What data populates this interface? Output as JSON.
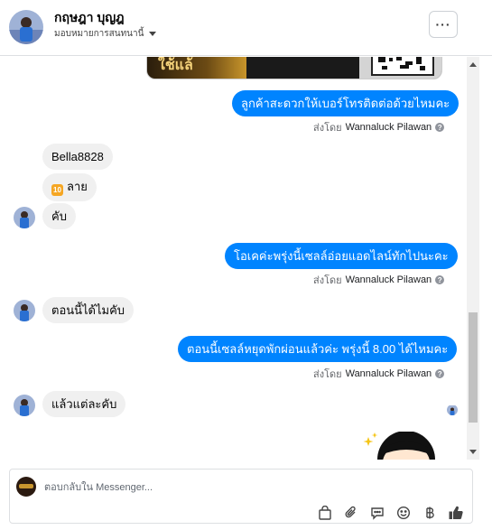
{
  "header": {
    "contact_name": "กฤษฎา บุญฎ",
    "assign_label": "มอบหมายการสนทนานี้",
    "more_label": "···"
  },
  "messages": {
    "m1": "ลูกค้าสะดวกให้เบอร์โทรติดต่อด้วยไหมคะ",
    "m2": "Bella8828",
    "m3_icon": "10",
    "m3": "ลาย",
    "m4": "คับ",
    "m5": "โอเคค่ะพรุ่งนี้เซลล์อ่อยแอดไลน์ทักไปนะคะ",
    "m6": "ตอนนี้ได้ไมคับ",
    "m7": "ตอนนี้เซลล์หยุดพักผ่อนแล้วค่ะ  พรุ่งนี้ 8.00 ได้ไหมคะ",
    "m8": "แล้วแต่ละคับ"
  },
  "sent_by": {
    "prefix": "ส่งโดย",
    "agent": "Wannaluck Pilawan",
    "help": "?"
  },
  "composer": {
    "placeholder": "ตอบกลับใน Messenger..."
  },
  "icons": {
    "tools": [
      "bag-icon",
      "paperclip-icon",
      "speech-bubble-icon",
      "smiley-icon",
      "baht-icon",
      "thumbs-up-icon"
    ]
  },
  "colors": {
    "outgoing_bubble": "#0084ff",
    "incoming_bubble": "#f0f0f0"
  }
}
